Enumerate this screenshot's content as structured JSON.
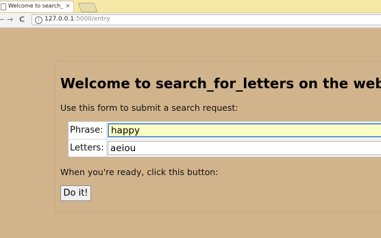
{
  "browser": {
    "tab_title": "Welcome to search_for_",
    "tab_close": "×",
    "url_host": "127.0.0.1",
    "url_path": ":5000/entry",
    "info_symbol": "i",
    "back_symbol": "←",
    "forward_symbol": "→",
    "reload_symbol": "C"
  },
  "page": {
    "background_color": "#d2b48c",
    "heading": "Welcome to search_for_letters on the web!",
    "intro": "Use this form to submit a search request:",
    "form": {
      "phrase_label": "Phrase:",
      "phrase_value": "happy",
      "letters_label": "Letters:",
      "letters_value": "aeiou"
    },
    "ready_text": "When you're ready, click this button:",
    "submit_label": "Do it!"
  }
}
